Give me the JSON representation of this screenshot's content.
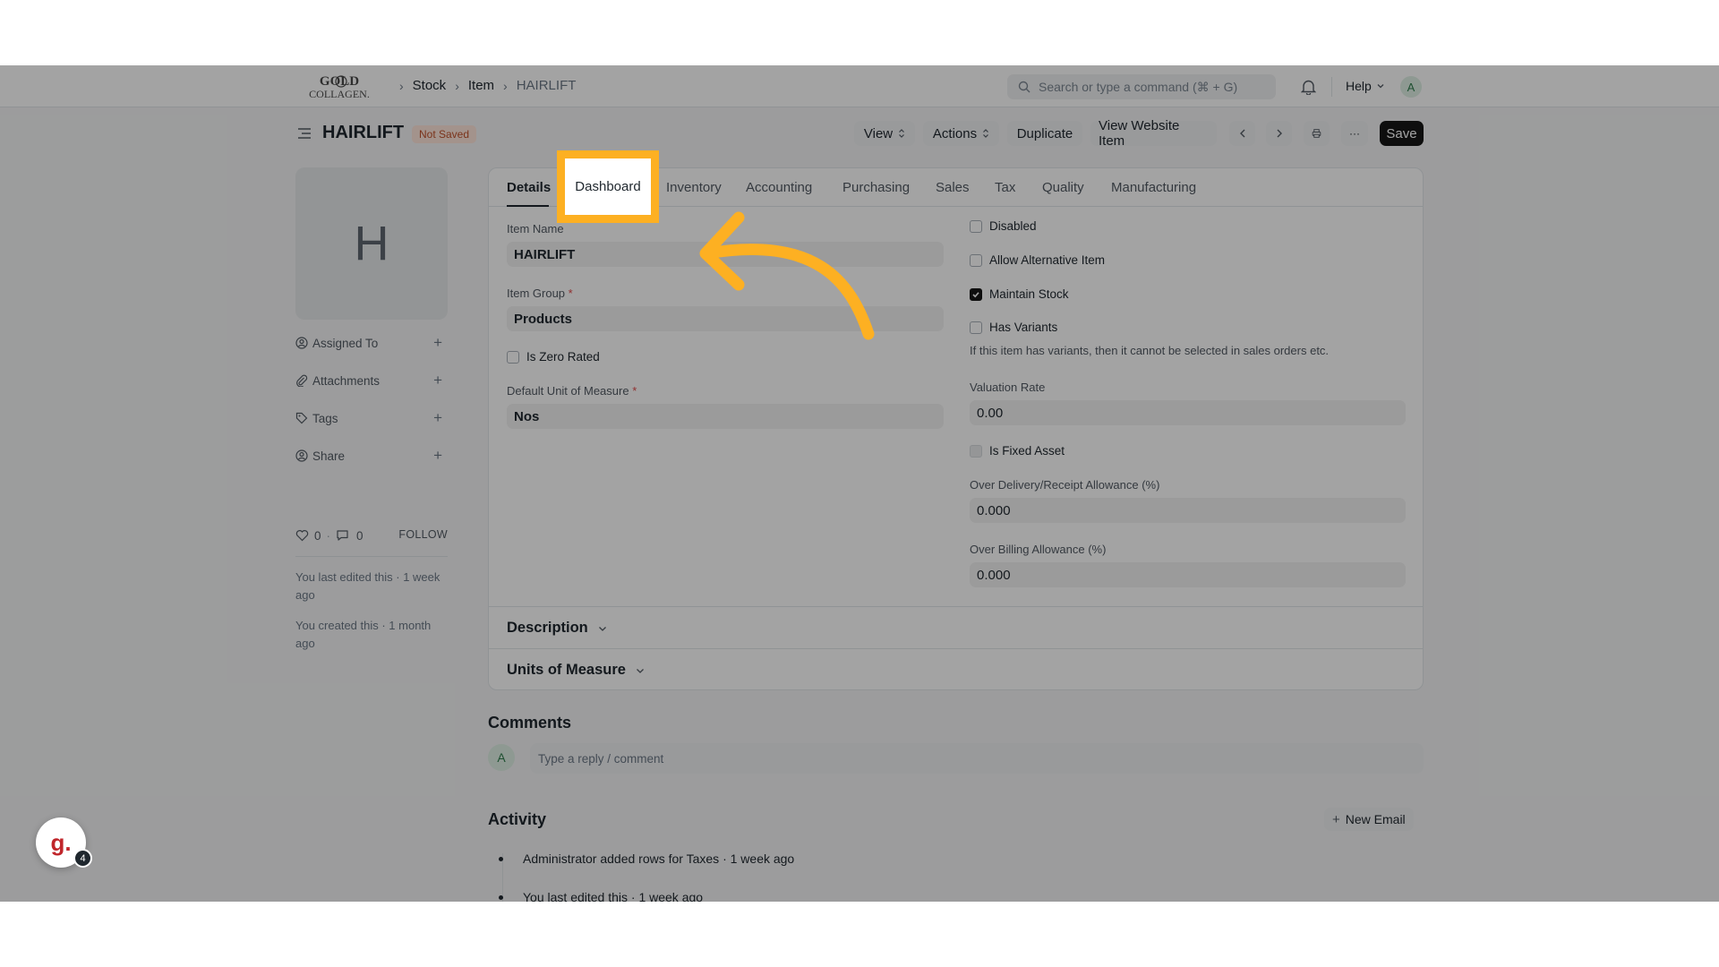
{
  "navbar": {
    "logo_text": "GOLD COLLAGEN",
    "breadcrumbs": [
      "Stock",
      "Item",
      "HAIRLIFT"
    ],
    "search_placeholder": "Search or type a command (⌘ + G)",
    "help_label": "Help",
    "avatar_initial": "A"
  },
  "page": {
    "title": "HAIRLIFT",
    "status": "Not Saved",
    "buttons": {
      "view": "View",
      "actions": "Actions",
      "duplicate": "Duplicate",
      "view_website_item": "View Website Item",
      "more": "···",
      "save": "Save"
    }
  },
  "sidebar": {
    "image_initial": "H",
    "items": [
      {
        "label": "Assigned To",
        "icon": "assign-icon"
      },
      {
        "label": "Attachments",
        "icon": "paperclip-icon"
      },
      {
        "label": "Tags",
        "icon": "tag-icon"
      },
      {
        "label": "Share",
        "icon": "share-icon"
      }
    ],
    "likes": "0",
    "comments": "0",
    "follow_label": "FOLLOW",
    "last_edited": "You last edited this · 1 week ago",
    "created": "You created this · 1 month ago"
  },
  "tabs": [
    "Details",
    "Dashboard",
    "Inventory",
    "Accounting",
    "Purchasing",
    "Sales",
    "Tax",
    "Quality",
    "Manufacturing"
  ],
  "form": {
    "item_name_label": "Item Name",
    "item_name_value": "HAIRLIFT",
    "item_group_label": "Item Group",
    "item_group_value": "Products",
    "is_zero_rated_label": "Is Zero Rated",
    "uom_label": "Default Unit of Measure",
    "uom_value": "Nos",
    "disabled_label": "Disabled",
    "allow_alternative_label": "Allow Alternative Item",
    "maintain_stock_label": "Maintain Stock",
    "has_variants_label": "Has Variants",
    "has_variants_help": "If this item has variants, then it cannot be selected in sales orders etc.",
    "valuation_rate_label": "Valuation Rate",
    "valuation_rate_value": "0.00",
    "is_fixed_asset_label": "Is Fixed Asset",
    "over_delivery_label": "Over Delivery/Receipt Allowance (%)",
    "over_delivery_value": "0.000",
    "over_billing_label": "Over Billing Allowance (%)",
    "over_billing_value": "0.000"
  },
  "sections": {
    "description": "Description",
    "units_of_measure": "Units of Measure"
  },
  "comments": {
    "title": "Comments",
    "avatar_initial": "A",
    "placeholder": "Type a reply / comment"
  },
  "activity": {
    "title": "Activity",
    "new_email_label": "New Email",
    "items": [
      "Administrator added rows for Taxes · 1 week ago",
      "You last edited this · 1 week ago"
    ]
  },
  "guide": {
    "logo_letter": "g.",
    "count": "4"
  },
  "colors": {
    "highlight": "#fdb022",
    "save_button": "#171717",
    "not_saved_badge": "#ffe7dc"
  }
}
